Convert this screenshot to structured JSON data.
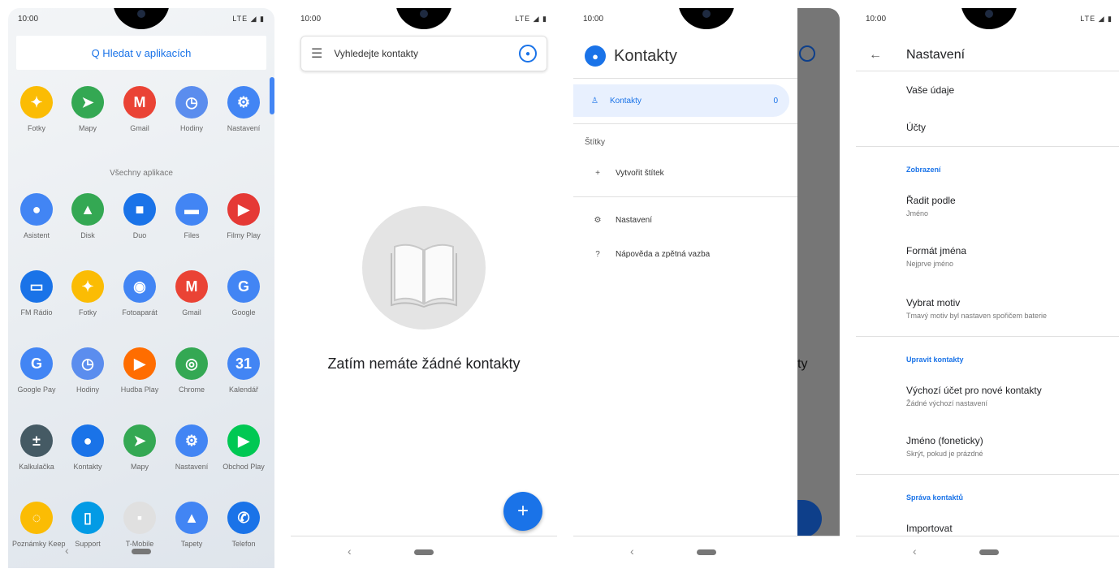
{
  "status": {
    "time": "10:00",
    "signal": "LTE ◢ ▮"
  },
  "launcher": {
    "search_placeholder": "Q Hledat v aplikacích",
    "section_all": "Všechny aplikace",
    "apps": [
      {
        "label": "Fotky",
        "icon": "photos-icon",
        "color": "#fbbc04"
      },
      {
        "label": "Mapy",
        "icon": "maps-icon",
        "color": "#34a853"
      },
      {
        "label": "Gmail",
        "icon": "gmail-icon",
        "color": "#ea4335"
      },
      {
        "label": "Hodiny",
        "icon": "clock-icon",
        "color": "#5b8dee"
      },
      {
        "label": "Nastavení",
        "icon": "settings-icon",
        "color": "#4285f4"
      },
      {
        "label": "Asistent",
        "icon": "assistant-icon",
        "color": "#4285f4"
      },
      {
        "label": "Disk",
        "icon": "drive-icon",
        "color": "#34a853"
      },
      {
        "label": "Duo",
        "icon": "duo-icon",
        "color": "#1a73e8"
      },
      {
        "label": "Files",
        "icon": "files-icon",
        "color": "#4285f4"
      },
      {
        "label": "Filmy Play",
        "icon": "play-movies-icon",
        "color": "#e53935"
      },
      {
        "label": "FM Rádio",
        "icon": "fm-radio-icon",
        "color": "#1a73e8"
      },
      {
        "label": "Fotky",
        "icon": "photos-icon",
        "color": "#fbbc04"
      },
      {
        "label": "Fotoaparát",
        "icon": "camera-icon",
        "color": "#4285f4"
      },
      {
        "label": "Gmail",
        "icon": "gmail-icon",
        "color": "#ea4335"
      },
      {
        "label": "Google",
        "icon": "google-icon",
        "color": "#4285f4"
      },
      {
        "label": "Google Pay",
        "icon": "google-pay-icon",
        "color": "#4285f4"
      },
      {
        "label": "Hodiny",
        "icon": "clock-icon",
        "color": "#5b8dee"
      },
      {
        "label": "Hudba Play",
        "icon": "play-music-icon",
        "color": "#ff6d00"
      },
      {
        "label": "Chrome",
        "icon": "chrome-icon",
        "color": "#34a853"
      },
      {
        "label": "Kalendář",
        "icon": "calendar-icon",
        "color": "#4285f4"
      },
      {
        "label": "Kalkulačka",
        "icon": "calculator-icon",
        "color": "#455a64"
      },
      {
        "label": "Kontakty",
        "icon": "contacts-icon",
        "color": "#1a73e8"
      },
      {
        "label": "Mapy",
        "icon": "maps-icon",
        "color": "#34a853"
      },
      {
        "label": "Nastavení",
        "icon": "settings-icon",
        "color": "#4285f4"
      },
      {
        "label": "Obchod Play",
        "icon": "play-store-icon",
        "color": "#00c853"
      },
      {
        "label": "Poznámky Keep",
        "icon": "keep-icon",
        "color": "#fbbc04"
      },
      {
        "label": "Support",
        "icon": "support-icon",
        "color": "#039be5"
      },
      {
        "label": "T-Mobile",
        "icon": "t-mobile-icon",
        "color": "#e0e0e0"
      },
      {
        "label": "Tapety",
        "icon": "wallpapers-icon",
        "color": "#4285f4"
      },
      {
        "label": "Telefon",
        "icon": "phone-icon",
        "color": "#1a73e8"
      }
    ]
  },
  "contacts": {
    "search_placeholder": "Vyhledejte kontakty",
    "empty_text": "Zatím nemáte žádné kontakty",
    "fab": "+"
  },
  "drawer": {
    "title": "Kontakty",
    "selected": {
      "label": "Kontakty",
      "count": "0"
    },
    "labels_header": "Štítky",
    "create_label": "Vytvořit štítek",
    "settings": "Nastavení",
    "help": "Nápověda a zpětná vazba",
    "behind_text": "kty"
  },
  "settings": {
    "title": "Nastavení",
    "rows": [
      {
        "title": "Vaše údaje",
        "sub": ""
      },
      {
        "title": "Účty",
        "sub": ""
      }
    ],
    "cat1": "Zobrazení",
    "display": [
      {
        "title": "Řadit podle",
        "sub": "Jméno"
      },
      {
        "title": "Formát jména",
        "sub": "Nejprve jméno"
      },
      {
        "title": "Vybrat motiv",
        "sub": "Tmavý motiv byl nastaven spořičem baterie"
      }
    ],
    "cat2": "Upravit kontakty",
    "edit": [
      {
        "title": "Výchozí účet pro nové kontakty",
        "sub": "Žádné výchozí nastavení"
      },
      {
        "title": "Jméno (foneticky)",
        "sub": "Skrýt, pokud je prázdné"
      }
    ],
    "cat3": "Správa kontaktů",
    "manage": [
      {
        "title": "Importovat",
        "sub": ""
      }
    ]
  }
}
